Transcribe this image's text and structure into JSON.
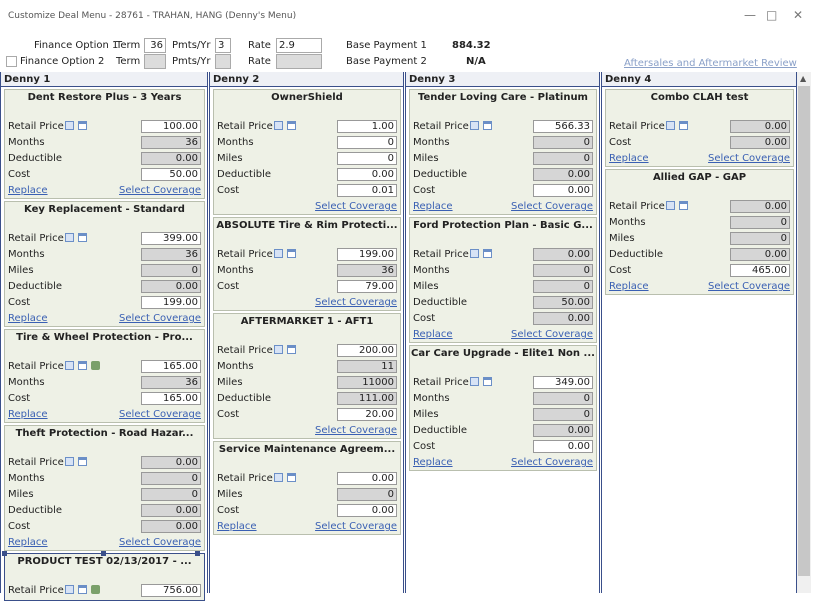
{
  "window": {
    "title": "Customize Deal Menu - 28761 - TRAHAN, HANG (Denny's Menu)",
    "minimize": "—",
    "maximize": "□",
    "close": "✕"
  },
  "finance": {
    "option1_label": "Finance Option 1",
    "option2_label": "Finance Option 2",
    "term_label": "Term",
    "pmts_label": "Pmts/Yr",
    "rate_label": "Rate",
    "option1_term": "36",
    "option1_pmts": "3",
    "option1_rate": "2.9",
    "option2_term": "",
    "option2_pmts": "",
    "option2_rate": "",
    "base_payment_1_label": "Base Payment 1",
    "base_payment_1": "884.32",
    "base_payment_2_label": "Base Payment 2",
    "base_payment_2": "N/A"
  },
  "aftersales_link": "Aftersales and Aftermarket Review",
  "links": {
    "replace": "Replace",
    "select_coverage": "Select Coverage"
  },
  "columns": [
    {
      "title": "Denny 1",
      "cards": [
        {
          "title": "Dent Restore Plus - 3 Years",
          "fields": [
            [
              "Retail Price",
              "100.00",
              "w"
            ],
            [
              "Months",
              "36",
              "g"
            ],
            [
              "Deductible",
              "0.00",
              "g"
            ],
            [
              "Cost",
              "50.00",
              "w"
            ]
          ],
          "car": false,
          "replace": true,
          "select": true
        },
        {
          "title": "Key Replacement - Standard",
          "fields": [
            [
              "Retail Price",
              "399.00",
              "w"
            ],
            [
              "Months",
              "36",
              "g"
            ],
            [
              "Miles",
              "0",
              "g"
            ],
            [
              "Deductible",
              "0.00",
              "g"
            ],
            [
              "Cost",
              "199.00",
              "w"
            ]
          ],
          "car": false,
          "replace": true,
          "select": true
        },
        {
          "title": "Tire & Wheel Protection - Pro...",
          "fields": [
            [
              "Retail Price",
              "165.00",
              "w"
            ],
            [
              "Months",
              "36",
              "g"
            ],
            [
              "Cost",
              "165.00",
              "w"
            ]
          ],
          "car": true,
          "replace": true,
          "select": true
        },
        {
          "title": "Theft Protection - Road Hazar...",
          "fields": [
            [
              "Retail Price",
              "0.00",
              "g"
            ],
            [
              "Months",
              "0",
              "g"
            ],
            [
              "Miles",
              "0",
              "g"
            ],
            [
              "Deductible",
              "0.00",
              "g"
            ],
            [
              "Cost",
              "0.00",
              "g"
            ]
          ],
          "car": false,
          "replace": true,
          "select": true
        },
        {
          "title": "PRODUCT TEST 02/13/2017 - ...",
          "fields": [
            [
              "Retail Price",
              "756.00",
              "w"
            ]
          ],
          "car": true,
          "replace": false,
          "select": false,
          "selected": true
        }
      ]
    },
    {
      "title": "Denny 2",
      "cards": [
        {
          "title": "OwnerShield",
          "fields": [
            [
              "Retail Price",
              "1.00",
              "w"
            ],
            [
              "Months",
              "0",
              "w"
            ],
            [
              "Miles",
              "0",
              "w"
            ],
            [
              "Deductible",
              "0.00",
              "w"
            ],
            [
              "Cost",
              "0.01",
              "w"
            ]
          ],
          "car": false,
          "replace": false,
          "select": true
        },
        {
          "title": "ABSOLUTE Tire & Rim Protecti...",
          "fields": [
            [
              "Retail Price",
              "199.00",
              "w"
            ],
            [
              "Months",
              "36",
              "g"
            ],
            [
              "Cost",
              "79.00",
              "w"
            ]
          ],
          "car": false,
          "replace": false,
          "select": true
        },
        {
          "title": "AFTERMARKET 1 - AFT1",
          "fields": [
            [
              "Retail Price",
              "200.00",
              "w"
            ],
            [
              "Months",
              "11",
              "g"
            ],
            [
              "Miles",
              "11000",
              "g"
            ],
            [
              "Deductible",
              "111.00",
              "g"
            ],
            [
              "Cost",
              "20.00",
              "w"
            ]
          ],
          "car": false,
          "replace": false,
          "select": true
        },
        {
          "title": "Service Maintenance Agreem...",
          "fields": [
            [
              "Retail Price",
              "0.00",
              "w"
            ],
            [
              "Miles",
              "0",
              "g"
            ],
            [
              "Cost",
              "0.00",
              "w"
            ]
          ],
          "car": false,
          "replace": true,
          "select": true
        }
      ]
    },
    {
      "title": "Denny 3",
      "cards": [
        {
          "title": "Tender Loving Care - Platinum",
          "fields": [
            [
              "Retail Price",
              "566.33",
              "w"
            ],
            [
              "Months",
              "0",
              "g"
            ],
            [
              "Miles",
              "0",
              "g"
            ],
            [
              "Deductible",
              "0.00",
              "g"
            ],
            [
              "Cost",
              "0.00",
              "w"
            ]
          ],
          "car": false,
          "replace": true,
          "select": true
        },
        {
          "title": "Ford Protection Plan - Basic G...",
          "fields": [
            [
              "Retail Price",
              "0.00",
              "g"
            ],
            [
              "Months",
              "0",
              "g"
            ],
            [
              "Miles",
              "0",
              "g"
            ],
            [
              "Deductible",
              "50.00",
              "g"
            ],
            [
              "Cost",
              "0.00",
              "g"
            ]
          ],
          "car": false,
          "replace": true,
          "select": true
        },
        {
          "title": "Car Care Upgrade - Elite1 Non ...",
          "fields": [
            [
              "Retail Price",
              "349.00",
              "w"
            ],
            [
              "Months",
              "0",
              "g"
            ],
            [
              "Miles",
              "0",
              "g"
            ],
            [
              "Deductible",
              "0.00",
              "g"
            ],
            [
              "Cost",
              "0.00",
              "w"
            ]
          ],
          "car": false,
          "replace": true,
          "select": true
        }
      ]
    },
    {
      "title": "Denny 4",
      "cards": [
        {
          "title": "Combo CLAH test",
          "fields": [
            [
              "Retail Price",
              "0.00",
              "g"
            ],
            [
              "Cost",
              "0.00",
              "g"
            ]
          ],
          "car": false,
          "replace": true,
          "select": true
        },
        {
          "title": "Allied GAP - GAP",
          "fields": [
            [
              "Retail Price",
              "0.00",
              "g"
            ],
            [
              "Months",
              "0",
              "g"
            ],
            [
              "Miles",
              "0",
              "g"
            ],
            [
              "Deductible",
              "0.00",
              "g"
            ],
            [
              "Cost",
              "465.00",
              "w"
            ]
          ],
          "car": false,
          "replace": true,
          "select": true
        }
      ]
    }
  ]
}
